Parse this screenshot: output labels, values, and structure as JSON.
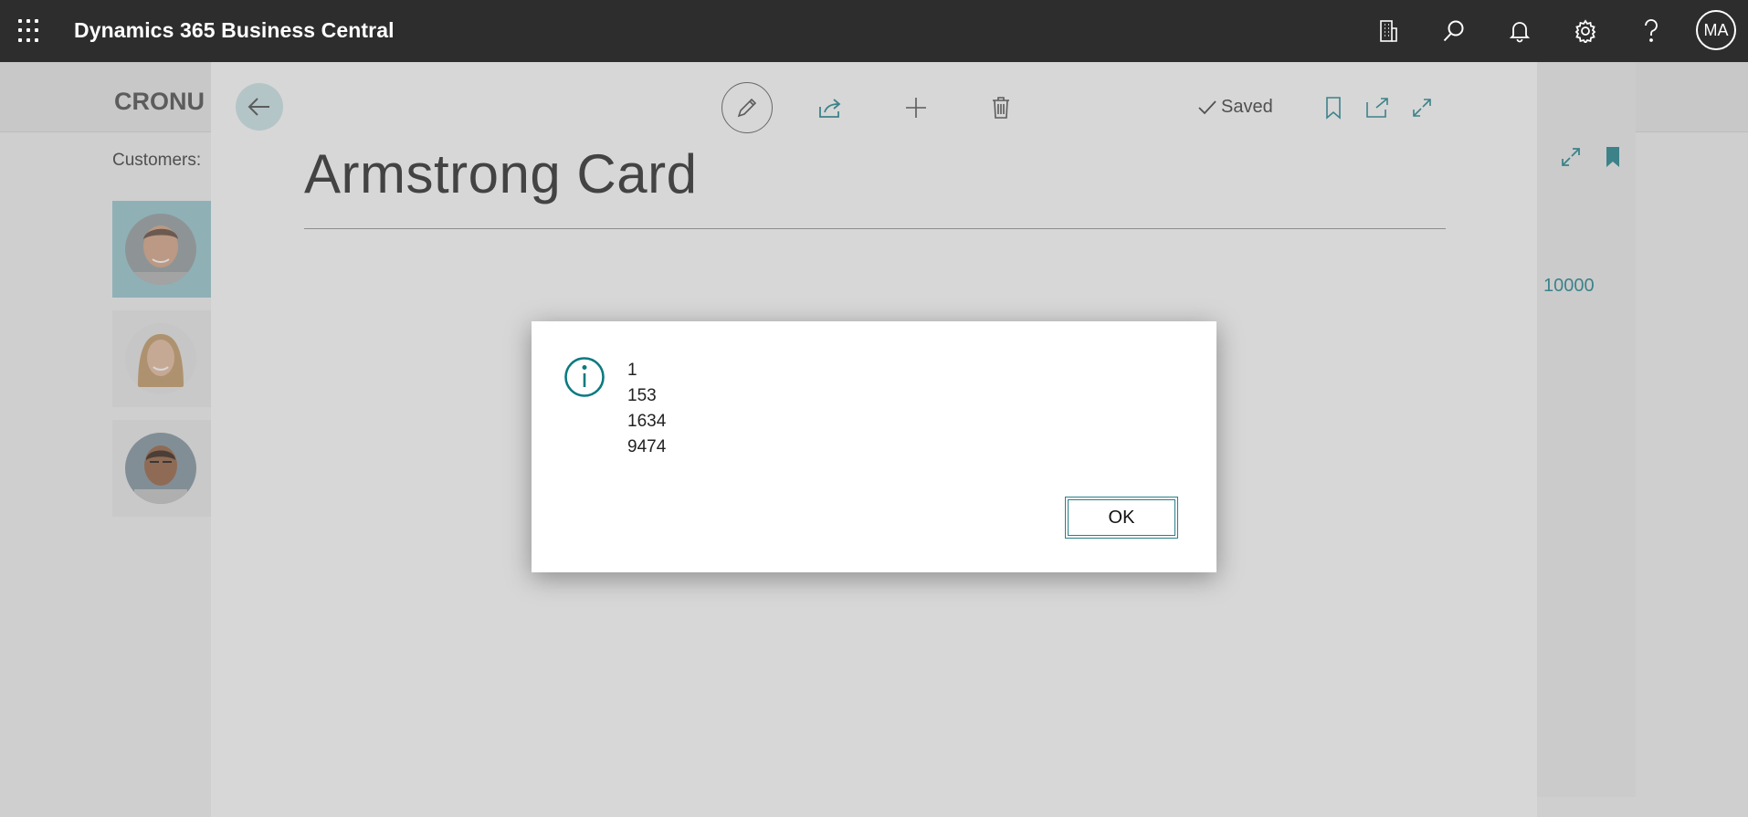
{
  "topbar": {
    "app_title": "Dynamics 365 Business Central",
    "user_initials": "MA",
    "icons": [
      "app-launcher-icon",
      "company-icon",
      "search-icon",
      "bell-icon",
      "gear-icon",
      "help-icon"
    ]
  },
  "background": {
    "company_name": "CRONU",
    "customers_label": "Customers:",
    "right_value": "10000",
    "accent_color": "#2a8a94"
  },
  "card": {
    "title": "Armstrong Card",
    "saved_label": "Saved",
    "icons": [
      "back-arrow-icon",
      "edit-pencil-icon",
      "share-icon",
      "plus-icon",
      "delete-icon",
      "bookmark-icon",
      "open-new-window-icon",
      "expand-icon"
    ]
  },
  "dialog": {
    "icon": "info-icon",
    "lines": [
      "1",
      "153",
      "1634",
      "9474"
    ],
    "ok_label": "OK"
  }
}
